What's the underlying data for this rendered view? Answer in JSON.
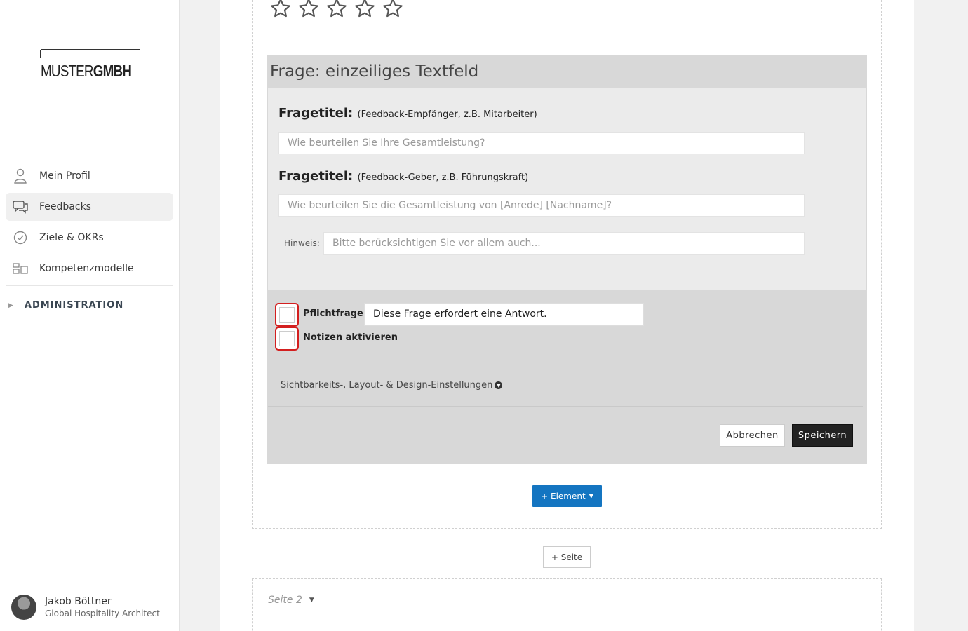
{
  "brand": {
    "logo_light": "MUSTER",
    "logo_bold": "GMBH"
  },
  "sidebar": {
    "items": [
      {
        "label": "Mein Profil",
        "icon": "user-icon"
      },
      {
        "label": "Feedbacks",
        "icon": "chat-icon",
        "active": true
      },
      {
        "label": "Ziele & OKRs",
        "icon": "check-circle-icon"
      },
      {
        "label": "Kompetenzmodelle",
        "icon": "grid-icon"
      }
    ],
    "admin_label": "ADMINISTRATION"
  },
  "user": {
    "name": "Jakob Böttner",
    "role": "Global Hospitality Architect"
  },
  "rating": {
    "stars_total": 5,
    "stars_filled": 0
  },
  "editor": {
    "title": "Frage: einzeiliges Textfeld",
    "q1": {
      "label": "Fragetitel:",
      "hint": "(Feedback-Empfänger, z.B. Mitarbeiter)",
      "placeholder": "Wie beurteilen Sie Ihre Gesamtleistung?"
    },
    "q2": {
      "label": "Fragetitel:",
      "hint": "(Feedback-Geber, z.B. Führungskraft)",
      "placeholder": "Wie beurteilen Sie die Gesamtleistung von [Anrede] [Nachname]?"
    },
    "hinweis": {
      "label": "Hinweis:",
      "placeholder": "Bitte berücksichtigen Sie vor allem auch..."
    },
    "pflicht": {
      "label": "Pflichtfrage",
      "value": "Diese Frage erfordert eine Antwort.",
      "checked": false
    },
    "notizen": {
      "label": "Notizen aktivieren",
      "checked": false
    },
    "settings_link": "Sichtbarkeits-, Layout- & Design-Einstellungen",
    "cancel_label": "Abbrechen",
    "save_label": "Speichern"
  },
  "add_element_label": "+ Element",
  "add_page_label": "+ Seite",
  "page2_label": "Seite 2",
  "colors": {
    "primary": "#1475c1",
    "danger_outline": "#d31f1f",
    "dark_button": "#222222"
  }
}
